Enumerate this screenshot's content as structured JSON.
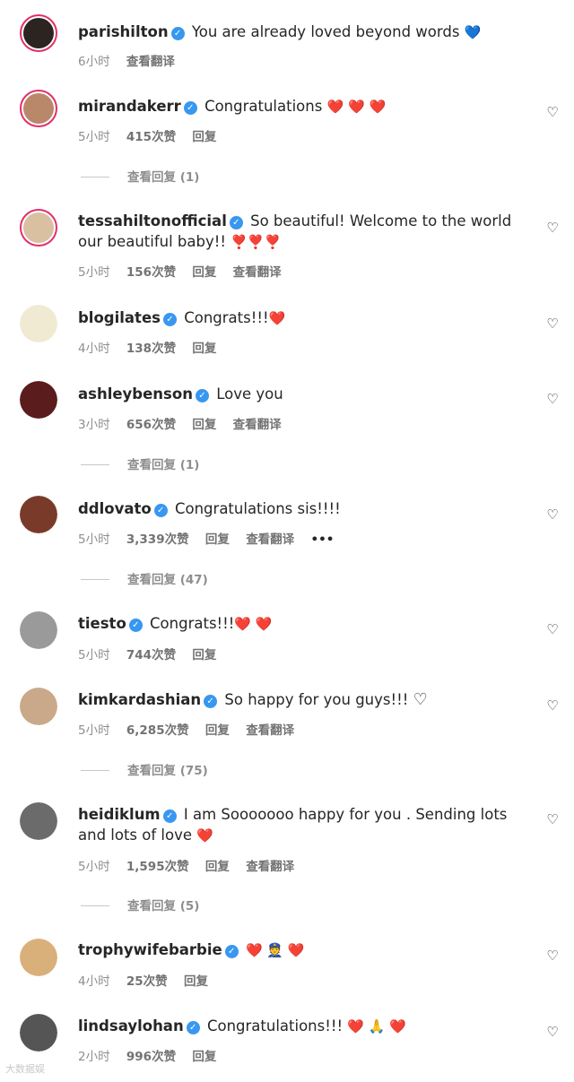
{
  "comments": [
    {
      "user": "parishilton",
      "text": "You are already loved beyond words",
      "emoji": "💙",
      "time": "6小时",
      "likes": "",
      "reply": "",
      "translate": "查看翻译",
      "replies": "",
      "avatar_color": "#c8a77a",
      "ring": true
    },
    {
      "user": "mirandakerr",
      "text": "Congratulations",
      "emoji": "❤️ ❤️ ❤️",
      "time": "5小时",
      "likes": "415次赞",
      "reply": "回复",
      "translate": "",
      "replies": "查看回复 (1)",
      "avatar_color": "#b9886a",
      "ring": true
    },
    {
      "user": "tessahiltonofficial",
      "text": "So beautiful! Welcome to the world our beautiful baby!!",
      "emoji": "❣️❣️❣️",
      "time": "5小时",
      "likes": "156次赞",
      "reply": "回复",
      "translate": "查看翻译",
      "replies": "",
      "avatar_color": "#d8c0a0",
      "ring": true
    },
    {
      "user": "blogilates",
      "text": "Congrats!!!",
      "emoji": "❤️",
      "time": "4小时",
      "likes": "138次赞",
      "reply": "回复",
      "translate": "",
      "replies": "",
      "avatar_color": "#e8d9a8",
      "ring": false
    },
    {
      "user": "ashleybenson",
      "text": "Love you",
      "emoji": "",
      "time": "3小时",
      "likes": "656次赞",
      "reply": "回复",
      "translate": "查看翻译",
      "replies": "查看回复 (1)",
      "avatar_color": "#5a1c1c",
      "ring": false
    },
    {
      "user": "ddlovato",
      "text": "Congratulations sis!!!!",
      "emoji": "",
      "time": "5小时",
      "likes": "3,339次赞",
      "reply": "回复",
      "translate": "查看翻译",
      "more": "•••",
      "replies": "查看回复 (47)",
      "avatar_color": "#7a3a2a",
      "ring": false
    },
    {
      "user": "tiesto",
      "text": "Congrats!!!",
      "emoji": "❤️ ❤️",
      "time": "5小时",
      "likes": "744次赞",
      "reply": "回复",
      "translate": "",
      "replies": "",
      "avatar_color": "#9a9a9a",
      "ring": false
    },
    {
      "user": "kimkardashian",
      "text": "So happy for you guys!!!",
      "emoji": "♡",
      "time": "5小时",
      "likes": "6,285次赞",
      "reply": "回复",
      "translate": "查看翻译",
      "replies": "查看回复 (75)",
      "avatar_color": "#caa98a",
      "ring": false
    },
    {
      "user": "heidiklum",
      "text": "I am Sooooooo happy for you . Sending lots and lots of love",
      "emoji": "❤️",
      "time": "5小时",
      "likes": "1,595次赞",
      "reply": "回复",
      "translate": "查看翻译",
      "replies": "查看回复 (5)",
      "avatar_color": "#6b6b6b",
      "ring": false
    },
    {
      "user": "trophywifebarbie",
      "text": "",
      "emoji": "❤️ 👮 ❤️",
      "time": "4小时",
      "likes": "25次赞",
      "reply": "回复",
      "translate": "",
      "replies": "",
      "avatar_color": "#d9b07a",
      "ring": false
    },
    {
      "user": "lindsaylohan",
      "text": "Congratulations!!!",
      "emoji": "❤️ 🙏 ❤️",
      "time": "2小时",
      "likes": "996次赞",
      "reply": "回复",
      "translate": "",
      "replies": "",
      "avatar_color": "#555555",
      "ring": false
    }
  ],
  "watermark": "大数据娱"
}
